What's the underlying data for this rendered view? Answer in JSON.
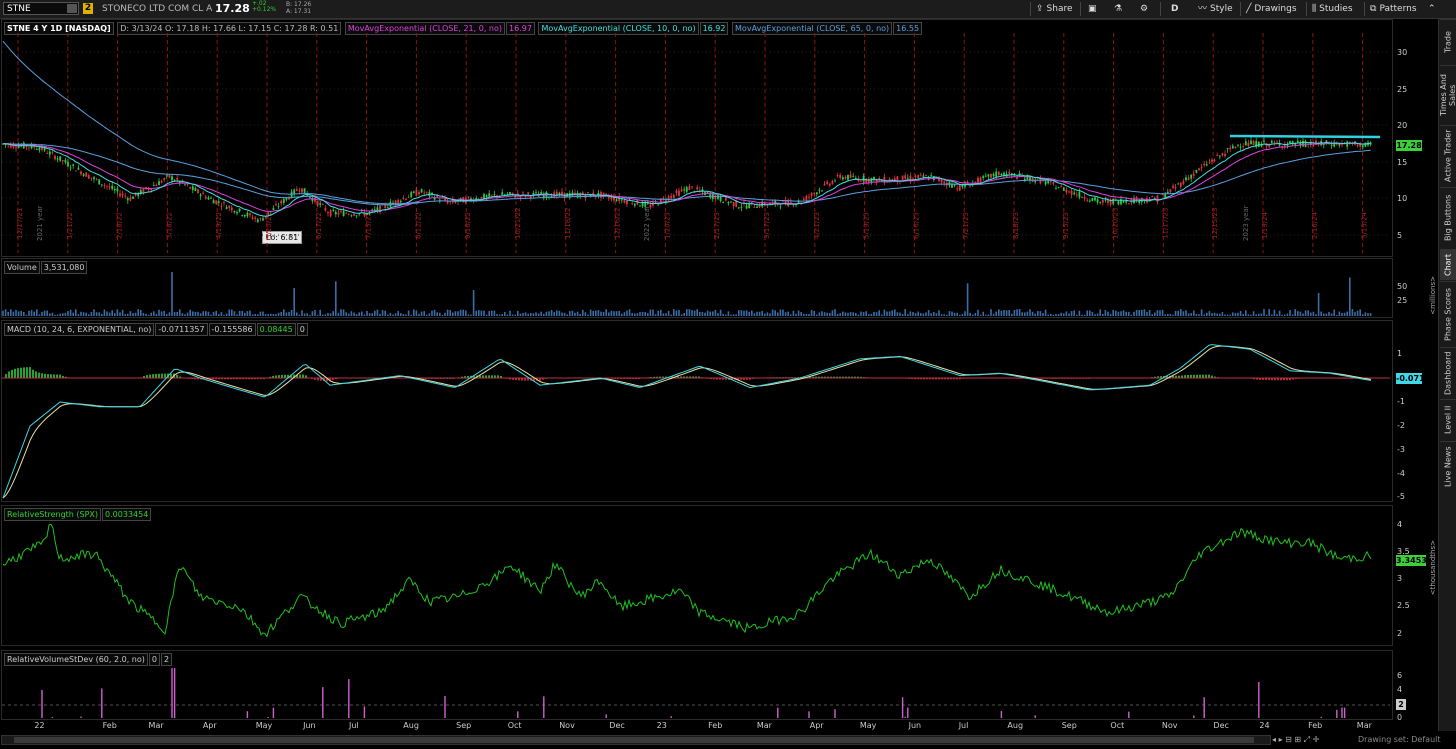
{
  "topbar": {
    "symbol": "STNE",
    "link_number": "2",
    "description": "STONECO LTD COM CL A",
    "last": "17.28",
    "change": "+.02",
    "change_pct": "+0.12%",
    "bid": "B: 17.26",
    "ask": "A: 17.31",
    "share_label": "Share",
    "period_label": "D",
    "style_label": "Style",
    "drawings_label": "Drawings",
    "studies_label": "Studies",
    "patterns_label": "Patterns"
  },
  "price_panel": {
    "header": "STNE 4 Y 1D [NASDAQ]",
    "ohlc": "D: 3/13/24   O: 17.18   H: 17.66   L: 17.15   C: 17.28   R: 0.51",
    "ema21_label": "MovAvgExponential (CLOSE, 21, 0, no)",
    "ema21_value": "16.97",
    "ema10_label": "MovAvgExponential (CLOSE, 10, 0, no)",
    "ema10_value": "16.92",
    "ema65_label": "MovAvgExponential (CLOSE, 65, 0, no)",
    "ema65_value": "16.55",
    "price_tag": "17.28",
    "lo_label": "Lo: 6.81",
    "axis_ticks": [
      "30",
      "25",
      "20",
      "15",
      "10",
      "5"
    ],
    "date_marks": [
      "12/17/21",
      "1/21/22",
      "2/18/22",
      "3/18/22",
      "4/19/22",
      "5/20/22",
      "6/17/22",
      "7/15/22",
      "8/12/22",
      "9/16/22",
      "10/21/22",
      "11/18/22",
      "12/16/22",
      "1/20/23",
      "2/17/23",
      "3/17/23",
      "4/21/23",
      "5/19/23",
      "6/16/23",
      "7/21/23",
      "8/18/23",
      "9/15/23",
      "10/20/23",
      "11/17/23",
      "12/15/23",
      "1/19/24",
      "2/16/24",
      "3/15/24"
    ],
    "year_marks": [
      "2021 year",
      "2022 year",
      "2023 year"
    ]
  },
  "volume_panel": {
    "label": "Volume",
    "value": "3,531,080",
    "axis_ticks": [
      "50",
      "25"
    ],
    "unit": "<millions>"
  },
  "macd_panel": {
    "label": "MACD (10, 24, 6, EXPONENTIAL, no)",
    "v1": "-0.0711357",
    "v2": "-0.155586",
    "v3": "0.08445",
    "v4": "0",
    "tag": "-0.0711",
    "axis_ticks": [
      "1",
      "0",
      "-1",
      "-2",
      "-3",
      "-4",
      "-5"
    ]
  },
  "rs_panel": {
    "label": "RelativeStrength (SPX)",
    "value": "0.0033454",
    "tag": "3.34539",
    "axis_ticks": [
      "4",
      "3.5",
      "3",
      "2.5",
      "2"
    ],
    "unit": "<thousandths>"
  },
  "rv_panel": {
    "label": "RelativeVolumeStDev (60, 2.0, no)",
    "v1": "0",
    "v2": "2",
    "tag": "2",
    "axis_ticks": [
      "6",
      "4",
      "2",
      "0"
    ]
  },
  "time_axis": [
    {
      "label": "22",
      "pos": 0.024
    },
    {
      "label": "Feb",
      "pos": 0.073
    },
    {
      "label": "Mar",
      "pos": 0.106
    },
    {
      "label": "Apr",
      "pos": 0.145
    },
    {
      "label": "May",
      "pos": 0.183
    },
    {
      "label": "Jun",
      "pos": 0.217
    },
    {
      "label": "Jul",
      "pos": 0.25
    },
    {
      "label": "Aug",
      "pos": 0.289
    },
    {
      "label": "Sep",
      "pos": 0.327
    },
    {
      "label": "Oct",
      "pos": 0.364
    },
    {
      "label": "Nov",
      "pos": 0.401
    },
    {
      "label": "Dec",
      "pos": 0.437
    },
    {
      "label": "23",
      "pos": 0.471
    },
    {
      "label": "Feb",
      "pos": 0.508
    },
    {
      "label": "Mar",
      "pos": 0.543
    },
    {
      "label": "Apr",
      "pos": 0.581
    },
    {
      "label": "May",
      "pos": 0.617
    },
    {
      "label": "Jun",
      "pos": 0.652
    },
    {
      "label": "Jul",
      "pos": 0.688
    },
    {
      "label": "Aug",
      "pos": 0.723
    },
    {
      "label": "Sep",
      "pos": 0.762
    },
    {
      "label": "Oct",
      "pos": 0.797
    },
    {
      "label": "Nov",
      "pos": 0.834
    },
    {
      "label": "Dec",
      "pos": 0.871
    },
    {
      "label": "24",
      "pos": 0.904
    },
    {
      "label": "Feb",
      "pos": 0.939
    },
    {
      "label": "Mar",
      "pos": 0.974
    }
  ],
  "sidebar_tabs": [
    "Trade",
    "Times And Sales",
    "Active Trader",
    "Big Buttons",
    "Chart",
    "Phase Scores",
    "Dashboard",
    "Level II",
    "Live News"
  ],
  "footer": {
    "drawing_set": "Drawing set: Default"
  },
  "colors": {
    "up": "#2ecc40",
    "down": "#e0353b",
    "ema21": "#e040e0",
    "ema10": "#40e0e0",
    "ema65": "#5aa0e0",
    "rs_line": "#20c020",
    "resistance": "#30d0e0"
  }
}
